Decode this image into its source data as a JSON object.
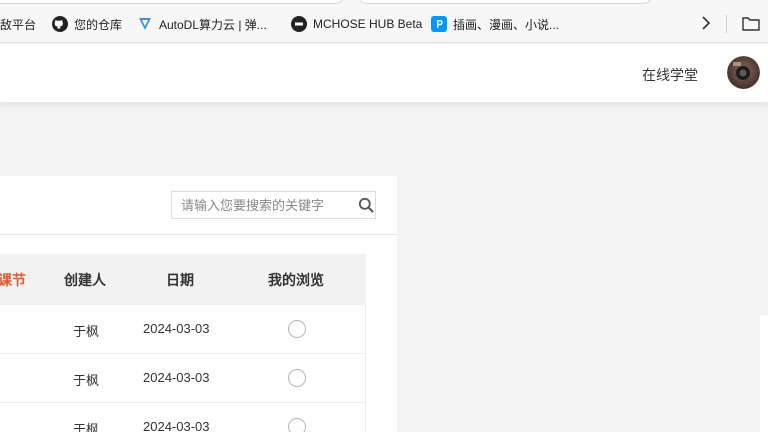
{
  "bookmarks": [
    {
      "label": "敌平台",
      "icon": "none"
    },
    {
      "label": "您的仓库",
      "icon": "github-icon"
    },
    {
      "label": "AutoDL算力云 | 弹...",
      "icon": "autodl-icon"
    },
    {
      "label": "MCHOSE HUB Beta",
      "icon": "mchose-icon"
    },
    {
      "label": "插画、漫画、小说...",
      "icon": "pixiv-icon"
    }
  ],
  "nav": {
    "link_label": "在线学堂"
  },
  "search": {
    "placeholder": "请输入您要搜索的关键字"
  },
  "table": {
    "headers": [
      "课节",
      "创建人",
      "日期",
      "我的浏览"
    ],
    "rows": [
      {
        "creator": "于枫",
        "date": "2024-03-03"
      },
      {
        "creator": "于枫",
        "date": "2024-03-03"
      },
      {
        "creator": "于枫",
        "date": "2024-03-03"
      }
    ]
  },
  "colors": {
    "accent": "#e4572e",
    "panel_bg": "#ffffff",
    "page_bg": "#f3f3f3"
  }
}
